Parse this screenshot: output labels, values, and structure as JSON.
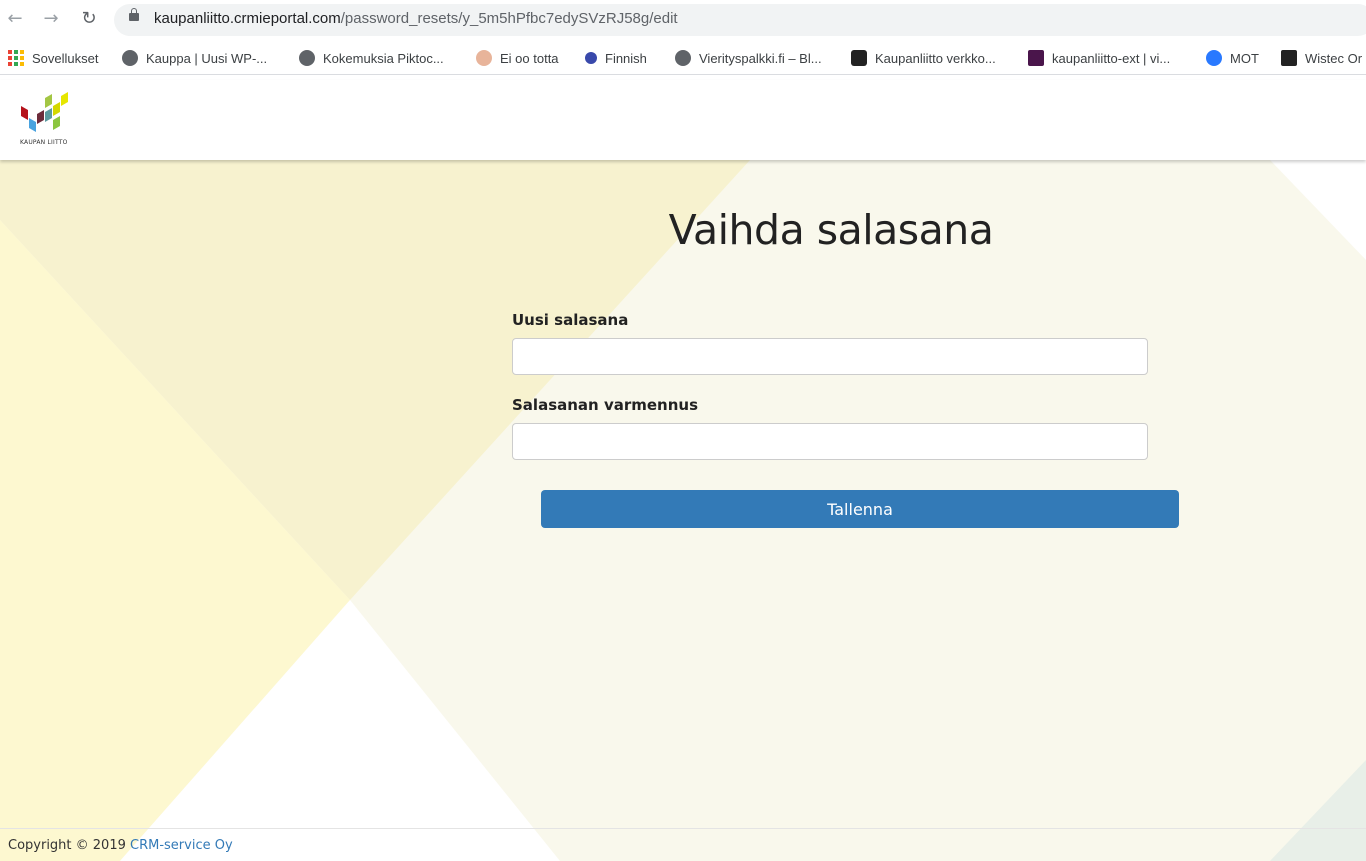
{
  "browser": {
    "url_domain": "kaupanliitto.crmieportal.com",
    "url_path": "/password_resets/y_5m5hPfbc7edySVzRJ58g/edit",
    "nav_icons": [
      "back-arrow-icon",
      "forward-arrow-icon",
      "reload-icon",
      "lock-icon"
    ]
  },
  "bookmarks": [
    {
      "label": "Sovellukset",
      "icon": "apps-icon"
    },
    {
      "label": "Kauppa | Uusi WP-...",
      "icon": "globe-icon"
    },
    {
      "label": "Kokemuksia Piktoc...",
      "icon": "globe-icon"
    },
    {
      "label": "Ei oo totta",
      "icon": "avatar-icon"
    },
    {
      "label": "Finnish",
      "icon": "dots-icon"
    },
    {
      "label": "Vierityspalkki.fi – Bl...",
      "icon": "globe-icon"
    },
    {
      "label": "Kaupanliitto verkko...",
      "icon": "trello-icon"
    },
    {
      "label": "kaupanliitto-ext | vi...",
      "icon": "slack-icon"
    },
    {
      "label": "MOT",
      "icon": "mot-icon"
    },
    {
      "label": "Wistec Or",
      "icon": "w-icon"
    }
  ],
  "header": {
    "logo_text": "KAUPAN LIITTO"
  },
  "form": {
    "title": "Vaihda salasana",
    "new_password_label": "Uusi salasana",
    "new_password_value": "",
    "confirm_password_label": "Salasanan varmennus",
    "confirm_password_value": "",
    "save_label": "Tallenna"
  },
  "footer": {
    "copyright": "Copyright © 2019",
    "company": "CRM-service Oy"
  },
  "colors": {
    "primary_button": "#337ab7",
    "bg_yellow": "#fbf7d5",
    "bg_light": "#f9f8ec"
  }
}
